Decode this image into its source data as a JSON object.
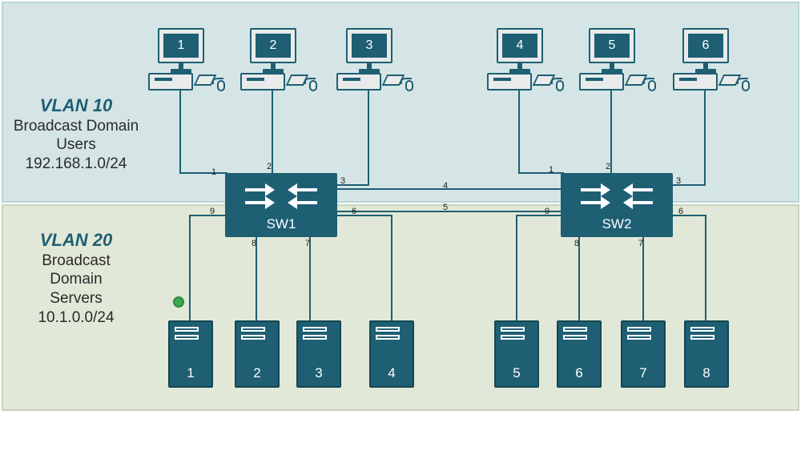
{
  "vlan10": {
    "name": "VLAN 10",
    "desc1": "Broadcast Domain",
    "desc2": "Users",
    "subnet": "192.168.1.0/24"
  },
  "vlan20": {
    "name": "VLAN 20",
    "desc1": "Broadcast Domain",
    "desc2": "Servers",
    "subnet": "10.1.0.0/24"
  },
  "pcs": {
    "1": "1",
    "2": "2",
    "3": "3",
    "4": "4",
    "5": "5",
    "6": "6"
  },
  "switches": {
    "sw1": "SW1",
    "sw2": "SW2"
  },
  "servers": {
    "1": "1",
    "2": "2",
    "3": "3",
    "4": "4",
    "5": "5",
    "6": "6",
    "7": "7",
    "8": "8"
  },
  "ports": {
    "sw1_p1": "1",
    "sw1_p2": "2",
    "sw1_p3": "3",
    "sw1_p4": "4",
    "sw1_p5": "5",
    "sw1_p6": "6",
    "sw1_p7": "7",
    "sw1_p8": "8",
    "sw1_p9": "9",
    "sw2_p1": "1",
    "sw2_p2": "2",
    "sw2_p3": "3",
    "sw2_p6": "6",
    "sw2_p7": "7",
    "sw2_p8": "8",
    "sw2_p9": "9"
  }
}
